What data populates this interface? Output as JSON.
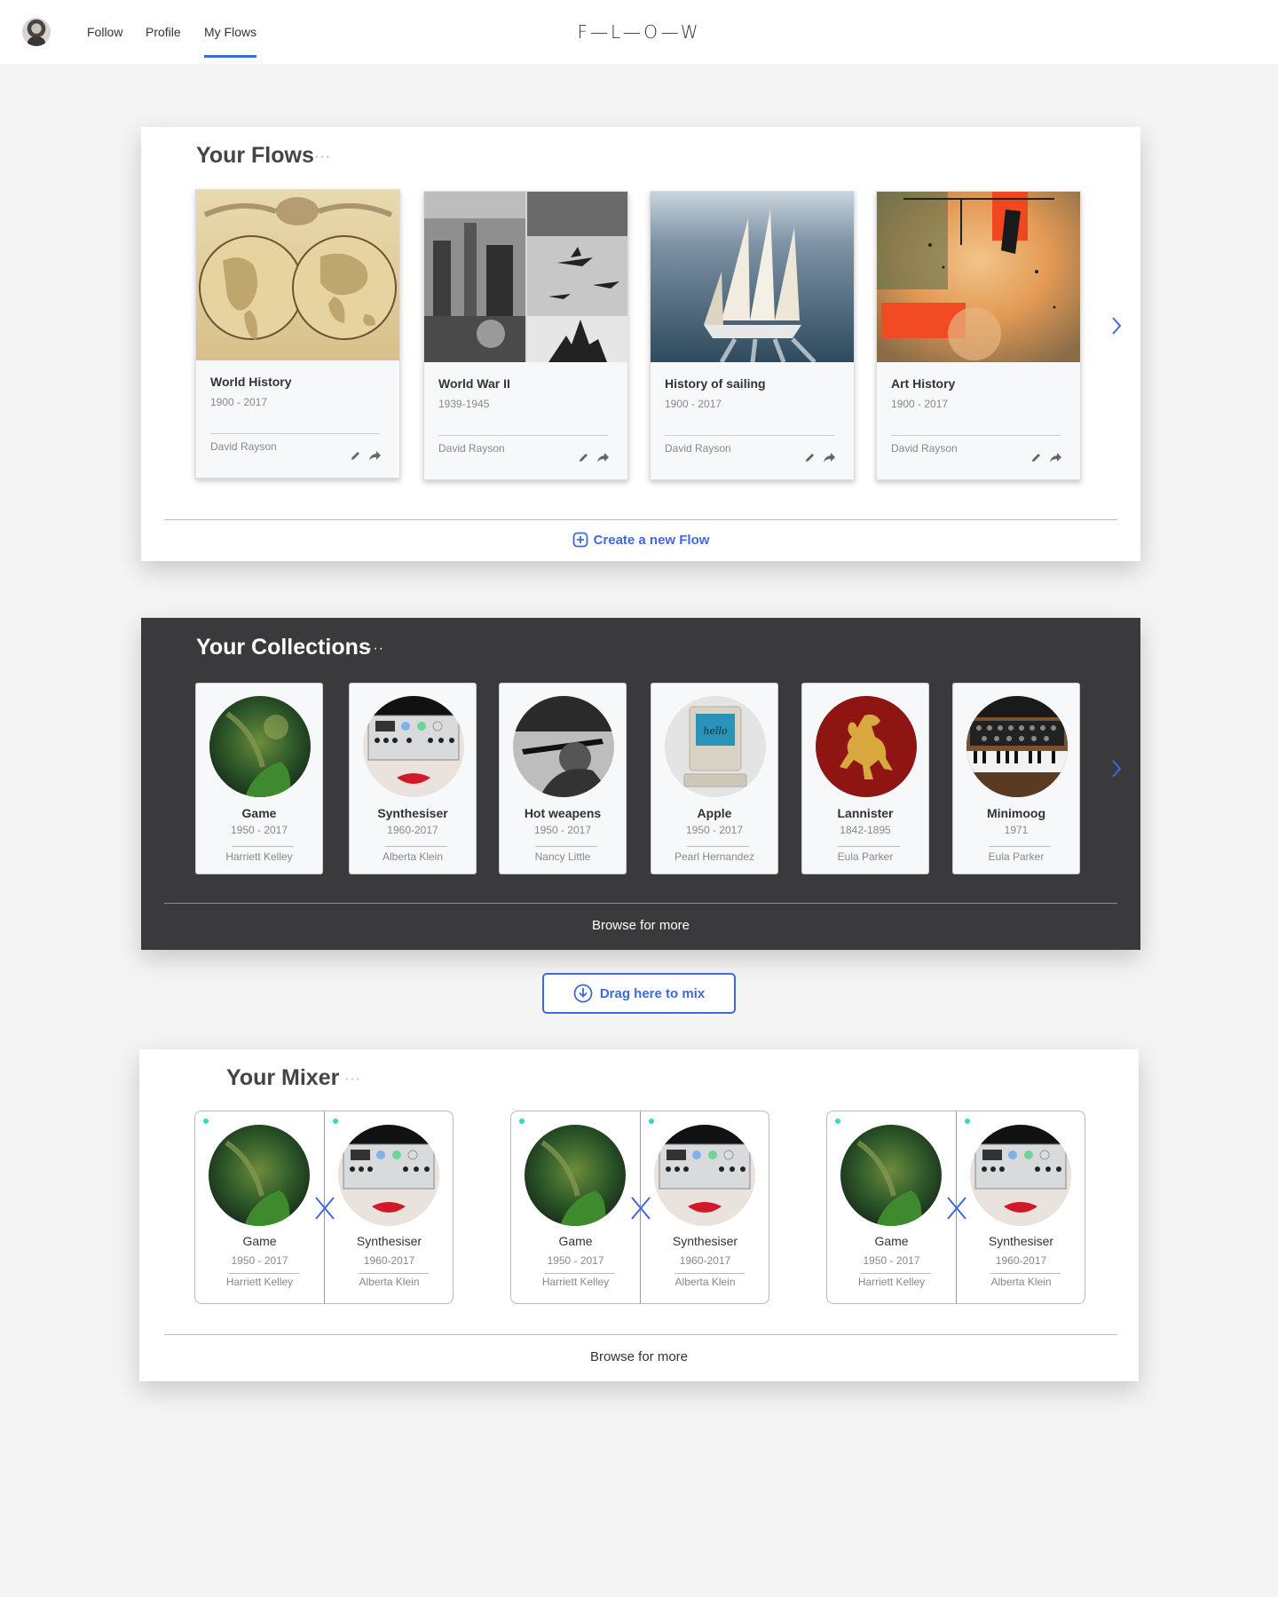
{
  "nav": {
    "links": [
      "Follow",
      "Profile",
      "My Flows"
    ],
    "active": "My Flows",
    "brand": "F—L—O—W",
    "accent": "#3d6ae0"
  },
  "flows": {
    "title": "Your Flows",
    "menu": "···",
    "cards": [
      {
        "title": "World History",
        "years": "1900 - 2017",
        "author": "David Rayson",
        "image": "antique-world-map"
      },
      {
        "title": "World War II",
        "years": "1939-1945",
        "author": "David Rayson",
        "image": "ww2-collage"
      },
      {
        "title": "History of sailing",
        "years": "1900 - 2017",
        "author": "David Rayson",
        "image": "sailing-ship"
      },
      {
        "title": "Art History",
        "years": "1900 - 2017",
        "author": "David Rayson",
        "image": "abstract-painting"
      }
    ],
    "create_label": "Create a new Flow"
  },
  "collections": {
    "title": "Your Collections",
    "menu": "···",
    "cards": [
      {
        "name": "Game",
        "years": "1950 - 2017",
        "author": "Harriett Kelley",
        "image": "jungle-game"
      },
      {
        "name": "Synthesiser",
        "years": "1960-2017",
        "author": "Alberta Klein",
        "image": "synth-lips"
      },
      {
        "name": "Hot weapens",
        "years": "1950 - 2017",
        "author": "Nancy Little",
        "image": "soldier-rifle"
      },
      {
        "name": "Apple",
        "years": "1950 - 2017",
        "author": "Pearl Hernandez",
        "image": "macintosh-hello"
      },
      {
        "name": "Lannister",
        "years": "1842-1895",
        "author": "Eula Parker",
        "image": "lannister-lion"
      },
      {
        "name": "Minimoog",
        "years": "1971",
        "author": "Eula Parker",
        "image": "minimoog-synth"
      }
    ],
    "browse_label": "Browse for more"
  },
  "drag": {
    "label": "Drag here to mix"
  },
  "mixer": {
    "title": "Your Mixer",
    "menu": "···",
    "pairs": [
      {
        "left": {
          "name": "Game",
          "years": "1950 - 2017",
          "author": "Harriett Kelley"
        },
        "right": {
          "name": "Synthesiser",
          "years": "1960-2017",
          "author": "Alberta Klein"
        }
      },
      {
        "left": {
          "name": "Game",
          "years": "1950 - 2017",
          "author": "Harriett Kelley"
        },
        "right": {
          "name": "Synthesiser",
          "years": "1960-2017",
          "author": "Alberta Klein"
        }
      },
      {
        "left": {
          "name": "Game",
          "years": "1950 - 2017",
          "author": "Harriett Kelley"
        },
        "right": {
          "name": "Synthesiser",
          "years": "1960-2017",
          "author": "Alberta Klein"
        }
      }
    ],
    "browse_label": "Browse for more"
  }
}
